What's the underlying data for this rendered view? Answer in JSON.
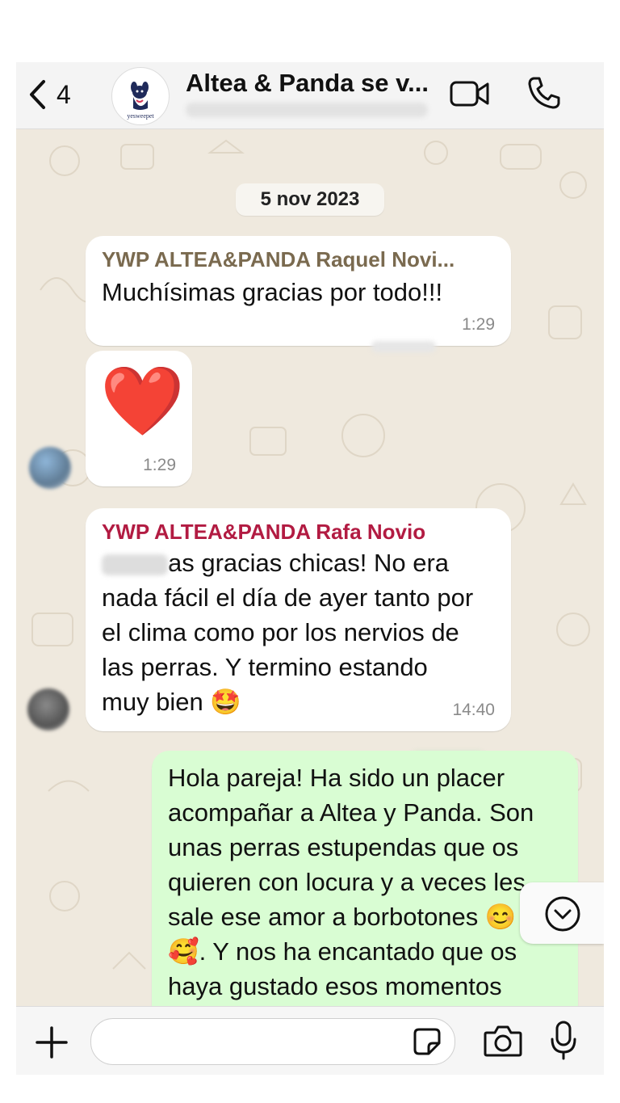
{
  "header": {
    "back_count": "4",
    "title": "Altea & Panda se v...",
    "avatar_text": "yesweepet"
  },
  "date_separator": "5 nov 2023",
  "messages": [
    {
      "sender": "YWP ALTEA&PANDA Raquel Novi...",
      "sender_color": "#7a6a4f",
      "text": "Muchísimas gracias por todo!!!",
      "time": "1:29"
    },
    {
      "emoji": "❤️",
      "time": "1:29"
    },
    {
      "sender": "YWP ALTEA&PANDA Rafa Novio",
      "sender_color": "#b21b42",
      "lines": [
        "as gracias chicas! No era",
        "nada fácil el día de ayer tanto por",
        "el clima como por los nervios de",
        "las perras. Y termino estando",
        "muy bien 🤩"
      ],
      "time": "14:40"
    },
    {
      "outgoing": true,
      "lines": [
        "Hola pareja! Ha sido un placer",
        "acompañar a Altea y Panda. Son",
        "unas perras estupendas que os",
        "quieren con locura y a veces les",
        "sale ese amor a borbotones 😊",
        "🥰. Y nos ha encantado que os",
        "haya gustado esos momentos"
      ]
    }
  ],
  "icons": {
    "back": "chevron-left-icon",
    "video": "video-camera-icon",
    "call": "phone-icon",
    "add": "plus-icon",
    "sticker": "sticker-icon",
    "camera": "camera-icon",
    "mic": "microphone-icon",
    "scroll": "chevron-down-circle-icon"
  },
  "colors": {
    "chat_background": "#efe9de",
    "outgoing_bubble": "#d9fdd3",
    "incoming_bubble": "#ffffff"
  }
}
